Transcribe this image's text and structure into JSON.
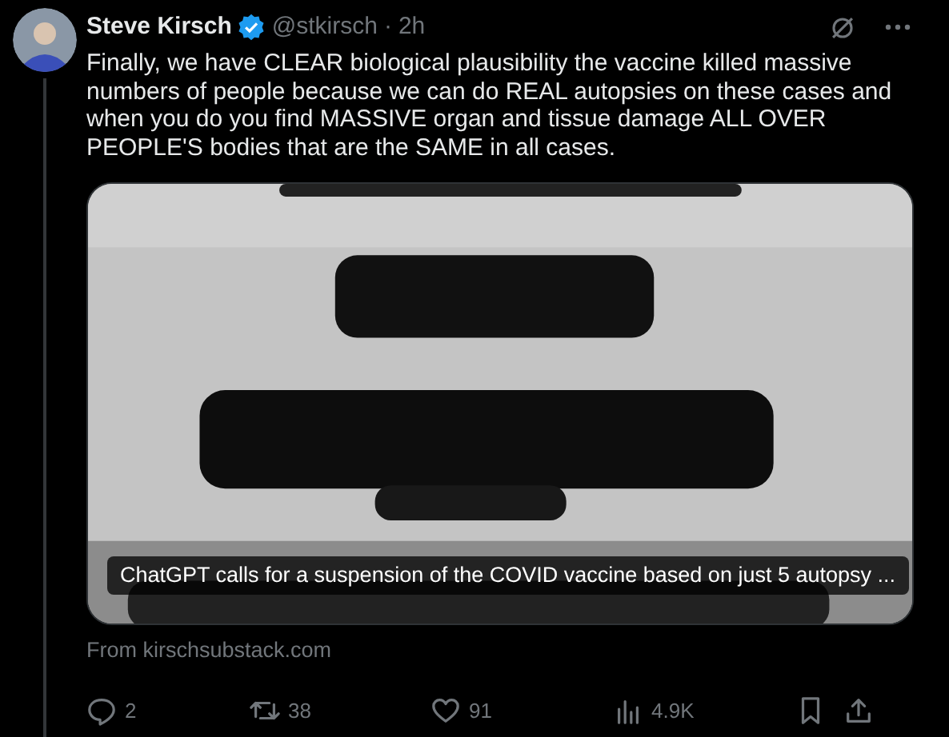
{
  "author": {
    "name": "Steve Kirsch",
    "verified": true,
    "handle": "@stkirsch",
    "separator": "·",
    "time": "2h"
  },
  "text": "Finally, we have CLEAR biological plausibility the vaccine killed massive numbers of people because we can do REAL autopsies on these cases and when you do you find MASSIVE organ and tissue damage ALL OVER PEOPLE'S bodies that are the SAME in all cases.",
  "card": {
    "caption": "ChatGPT calls for a suspension of the COVID vaccine based on just 5 autopsy ...",
    "source": "From kirschsubstack.com"
  },
  "actions": [
    {
      "kind": "reply",
      "count": "2"
    },
    {
      "kind": "repost",
      "count": "38"
    },
    {
      "kind": "like",
      "count": "91"
    },
    {
      "kind": "views",
      "count": "4.9K"
    },
    {
      "kind": "bookmark"
    },
    {
      "kind": "share"
    }
  ]
}
